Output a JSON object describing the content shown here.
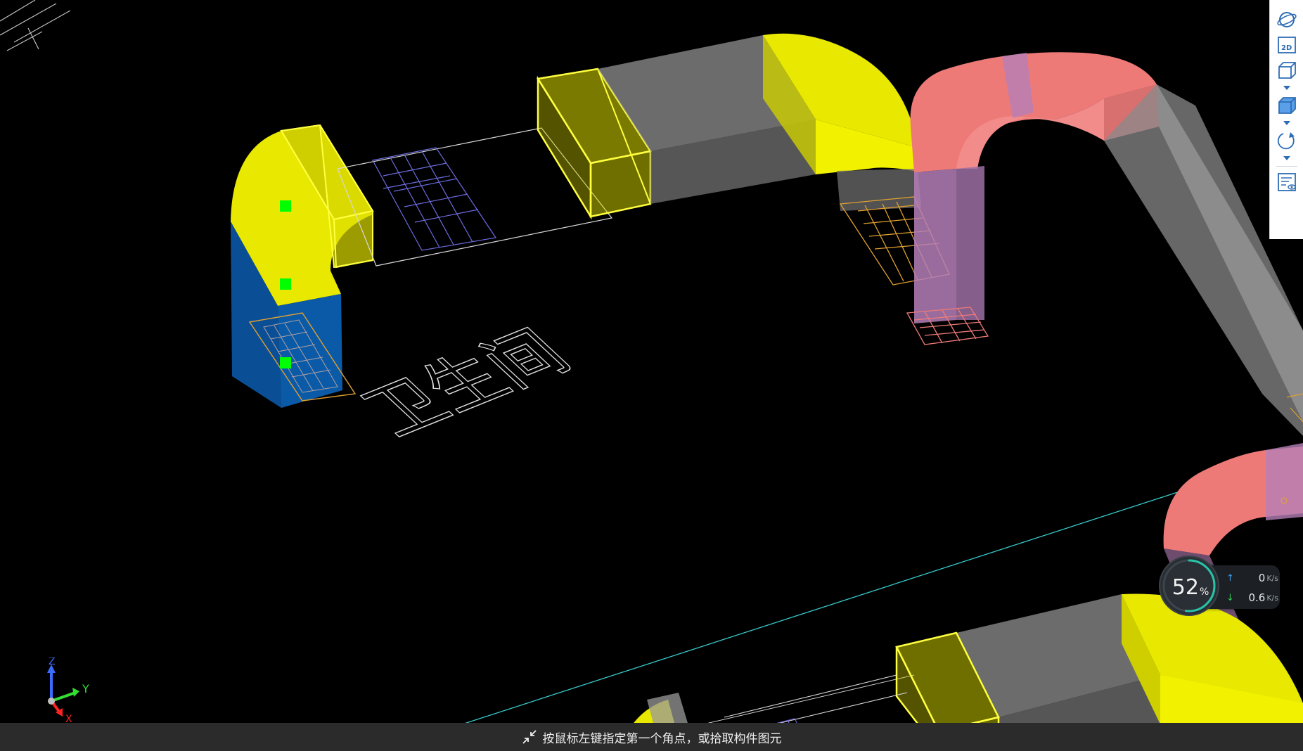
{
  "viewport": {
    "scene_text": [
      "卫生间"
    ]
  },
  "axis_labels": {
    "x": "X",
    "y": "Y",
    "z": "Z"
  },
  "toolbar": {
    "items": [
      {
        "icon": "orbit-icon"
      },
      {
        "icon": "view-2d-icon",
        "label": "2D"
      },
      {
        "icon": "cube-wireframe-icon"
      },
      {
        "icon": "cube-shaded-icon"
      },
      {
        "icon": "rotate-icon"
      },
      {
        "icon": "properties-view-icon"
      }
    ]
  },
  "status": {
    "hint": "按鼠标左键指定第一个角点，或拾取构件图元"
  },
  "network": {
    "percent_value": "52",
    "percent_sign": "%",
    "upload_value": "0",
    "download_value": "0.6",
    "unit": "K/s",
    "percent": 52
  },
  "colors": {
    "duct_yellow": "#e8e800",
    "duct_blue": "#0a4f96",
    "duct_pink": "#ee7a78",
    "duct_purple": "#b57fb8",
    "duct_gray": "#8a8a8a",
    "wire_blue": "#6c6ce0",
    "wire_orange": "#e0a030",
    "marker_green": "#00ff00",
    "cyan_line": "#38c8c8",
    "accent_teal": "#27c4a8"
  }
}
